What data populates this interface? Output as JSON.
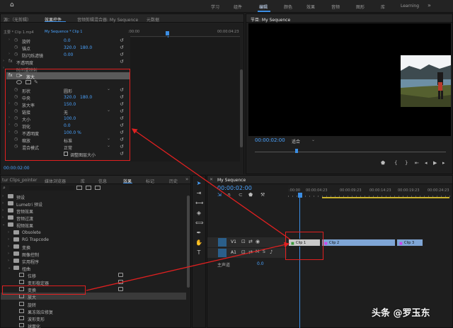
{
  "workspaces": [
    "学习",
    "组件",
    "编辑",
    "颜色",
    "效果",
    "音频",
    "图形",
    "库",
    "Learning"
  ],
  "workspace_active": "编辑",
  "effect_controls": {
    "tabs": [
      "源：（无剪辑）",
      "效果控件",
      "音频剪辑混合器: My Sequence",
      "元数据"
    ],
    "active_tab": "效果控件",
    "master_label": "主要 * Clip 1.mp4",
    "clip_label": "My Sequence * Clip 1",
    "timecode_start": ":00:00",
    "timecode_end": "00:00:04:23",
    "rows": [
      {
        "name": "旋转",
        "v1": "0.0"
      },
      {
        "name": "锚点",
        "v1": "320.0",
        "v2": "180.0"
      },
      {
        "name": "防闪烁滤镜",
        "v1": "0.00"
      },
      {
        "name": "不透明度"
      },
      {
        "name": "时间重映射"
      },
      {
        "name": "放大"
      },
      {
        "name": ""
      },
      {
        "name": "形状",
        "dd": "圆形"
      },
      {
        "name": "中央",
        "v1": "320.0",
        "v2": "180.0"
      },
      {
        "name": "放大率",
        "v1": "150.0"
      },
      {
        "name": "链接",
        "dd": "无"
      },
      {
        "name": "大小",
        "v1": "100.0"
      },
      {
        "name": "羽化",
        "v1": "0.0"
      },
      {
        "name": "不透明度",
        "v1": "100.0 %"
      },
      {
        "name": "缩放",
        "dd": "标准"
      },
      {
        "name": "混合模式",
        "dd": "正常"
      },
      {
        "name": "调整图层大小"
      }
    ],
    "current_time": "00:00:02:00"
  },
  "program": {
    "title": "节目: My Sequence",
    "timecode": "00:00:02:00",
    "fit": "适合"
  },
  "project": {
    "tabs": [
      "tur Clips_pointer",
      "媒体浏览器",
      "库",
      "信息",
      "效果",
      "标记",
      "历史"
    ],
    "active_tab": "效果",
    "tree": [
      {
        "label": "预设",
        "level": 0
      },
      {
        "label": "Lumetri 预设",
        "level": 0
      },
      {
        "label": "音频效果",
        "level": 0
      },
      {
        "label": "音频过渡",
        "level": 0
      },
      {
        "label": "视频效果",
        "level": 0,
        "open": true
      },
      {
        "label": "Obsolete",
        "level": 1
      },
      {
        "label": "RG Trapcode",
        "level": 1
      },
      {
        "label": "变换",
        "level": 1
      },
      {
        "label": "图像控制",
        "level": 1
      },
      {
        "label": "实用程序",
        "level": 1
      },
      {
        "label": "扭曲",
        "level": 1,
        "open": true
      },
      {
        "label": "位移",
        "level": 2,
        "accel": true
      },
      {
        "label": "变形稳定器",
        "level": 2,
        "accel": true
      },
      {
        "label": "变换",
        "level": 2,
        "accel": true
      },
      {
        "label": "放大",
        "level": 2,
        "selected": true
      },
      {
        "label": "旋转",
        "level": 2
      },
      {
        "label": "果冻效应修复",
        "level": 2
      },
      {
        "label": "波形变形",
        "level": 2
      },
      {
        "label": "球面化",
        "level": 2
      }
    ]
  },
  "timeline": {
    "title": "My Sequence",
    "timecode": "00:00:02:00",
    "ruler": [
      ":00:00",
      "00:00:04:23",
      "00:00:09:23",
      "00:00:14:23",
      "00:00:19:23",
      "00:00:24:23"
    ],
    "tracks": [
      "V1",
      "A1"
    ],
    "master": "主声道",
    "master_val": "0.0",
    "clips": [
      "Clip 1",
      "Clip 2",
      "Clip 3"
    ]
  },
  "watermark": "头条 @罗玉东",
  "colors": {
    "accent": "#3b8de3",
    "value": "#4aa3ff",
    "annotation": "#e02020",
    "clip": "#7fa6d6",
    "clip_sel": "#c9c9c9"
  }
}
